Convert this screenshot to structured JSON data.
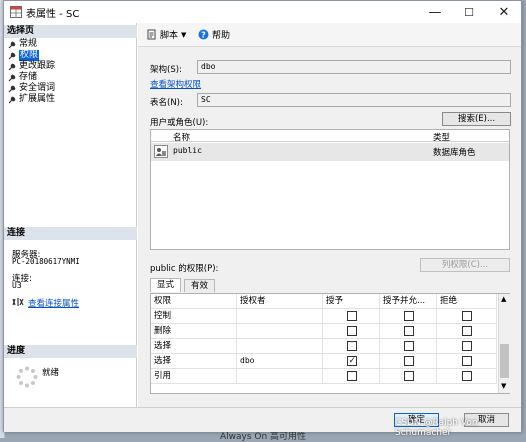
{
  "window": {
    "title": "表属性 - SC",
    "minimize": "—",
    "maximize": "☐",
    "close": "✕"
  },
  "left": {
    "section_select": "选择页",
    "pages": [
      {
        "label": "常规",
        "selected": false
      },
      {
        "label": "权限",
        "selected": true
      },
      {
        "label": "更改跟踪",
        "selected": false
      },
      {
        "label": "存储",
        "selected": false
      },
      {
        "label": "安全谓词",
        "selected": false
      },
      {
        "label": "扩展属性",
        "selected": false
      }
    ],
    "section_connection": "连接",
    "server_label": "服务器:",
    "server_value": "PC-20180617YNMI",
    "connection_label": "连接:",
    "connection_value": "U3",
    "view_connection_link": "查看连接属性",
    "section_progress": "进度",
    "progress_status": "就绪"
  },
  "toolbar": {
    "script_label": "脚本",
    "help_label": "帮助"
  },
  "form": {
    "schema_label": "架构(S):",
    "schema_value": "dbo",
    "view_schema_permissions": "查看架构权限",
    "table_name_label": "表名(N):",
    "table_name_value": "SC",
    "users_roles_label": "用户或角色(U):",
    "search_button": "搜索(E)..."
  },
  "principals_grid": {
    "headers": [
      "名称",
      "类型"
    ],
    "rows": [
      {
        "name": "public",
        "type": "数据库角色"
      }
    ]
  },
  "permissions": {
    "label": "public 的权限(P):",
    "column_permissions_button": "列权限(C)...",
    "tabs": [
      {
        "label": "显式",
        "active": true
      },
      {
        "label": "有效",
        "active": false
      }
    ],
    "headers": [
      "权限",
      "授权者",
      "授予",
      "授予并允...",
      "拒绝"
    ],
    "rows": [
      {
        "permission": "控制",
        "grantor": "",
        "grant": false,
        "with_grant": false,
        "deny": false
      },
      {
        "permission": "删除",
        "grantor": "",
        "grant": false,
        "with_grant": false,
        "deny": false
      },
      {
        "permission": "选择",
        "grantor": "",
        "grant": false,
        "with_grant": false,
        "deny": false
      },
      {
        "permission": "选择",
        "grantor": "dbo",
        "grant": true,
        "with_grant": false,
        "deny": false
      },
      {
        "permission": "引用",
        "grantor": "",
        "grant": false,
        "with_grant": false,
        "deny": false
      }
    ]
  },
  "footer": {
    "ok_button": "确定",
    "cancel_button": "取消"
  },
  "watermark": "CSDN @Ralph Von Schumacher",
  "background_text": "Always On 高可用性"
}
